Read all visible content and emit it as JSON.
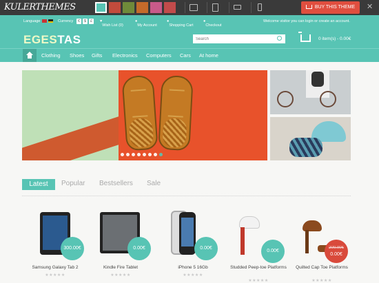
{
  "topbar": {
    "logo_text": "KULERTHEMES",
    "swatches": [
      "#58c4b4",
      "#c24b3c",
      "#6f8a3a",
      "#c46a2a",
      "#c85a8a",
      "#c24b4b",
      "#888888"
    ],
    "buy_label": "BUY THIS THEME"
  },
  "utilbar": {
    "language_label": "Language",
    "currency_label": "Currency",
    "currencies": [
      "€",
      "$",
      "£"
    ],
    "wishlist": "Wish List (0)",
    "account": "My Account",
    "cart": "Shopping Cart",
    "checkout": "Checkout",
    "welcome": "Welcome visitor you can login or create an account."
  },
  "header": {
    "logo_part1": "EGES",
    "logo_part2": "TAS",
    "search_placeholder": "Search",
    "cart_summary": "0 item(s) - 0.00€"
  },
  "nav": {
    "items": [
      "Clothing",
      "Shoes",
      "Gifts",
      "Electronics",
      "Computers",
      "Cars",
      "At home"
    ]
  },
  "tabs": [
    "Latest",
    "Popular",
    "Bestsellers",
    "Sale"
  ],
  "products": [
    {
      "name": "Samsung Galaxy Tab 2",
      "price": "300.00€",
      "rating": "★★★★★"
    },
    {
      "name": "Kindle Fire Tablet",
      "price": "0.00€",
      "rating": "★★★★★"
    },
    {
      "name": "iPhone 5 16Gb",
      "price": "0.00€",
      "rating": "★★★★★"
    },
    {
      "name": "Studded Peep-toe Platforms",
      "price": "0.00€",
      "rating": "★★★★★"
    },
    {
      "name": "Quilted Cap Toe Platforms",
      "old_price": "200.00€",
      "price": "0.00€",
      "rating": "★★★★★"
    }
  ],
  "colors": {
    "accent": "#58c4b4",
    "sale": "#d94a3b",
    "buy": "#e04e3f"
  }
}
